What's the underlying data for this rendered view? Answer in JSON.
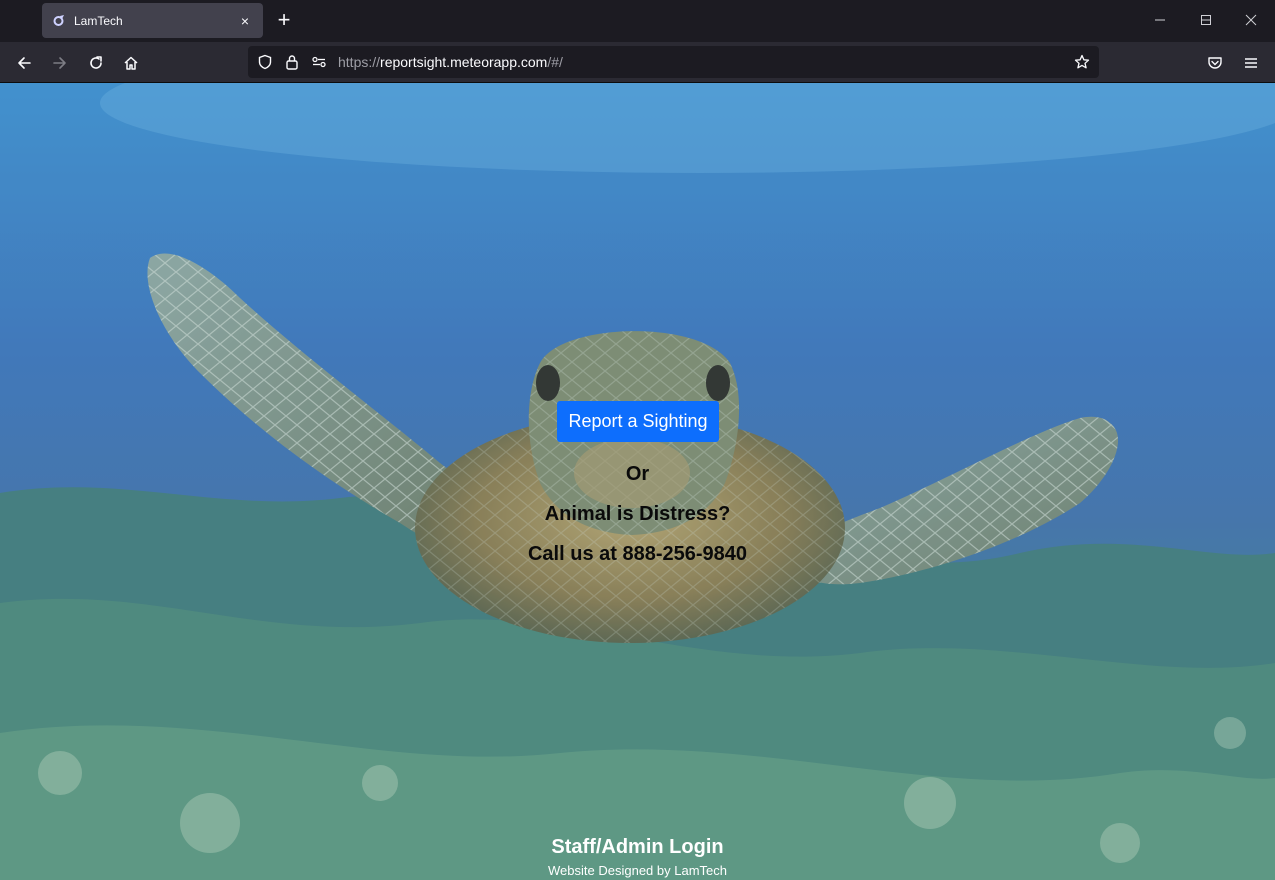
{
  "browser": {
    "tab_title": "LamTech",
    "tab_close": "×",
    "new_tab": "+",
    "url_scheme": "https://",
    "url_host": "reportsight.meteorapp.com",
    "url_path": "/#/"
  },
  "page": {
    "report_button": "Report a Sighting",
    "or_text": "Or",
    "distress_text": "Animal is Distress?",
    "call_text": "Call us at 888-256-9840",
    "login_link": "Staff/Admin Login",
    "credit": "Website Designed by LamTech"
  },
  "colors": {
    "accent": "#0d6efd",
    "chrome_dark": "#1c1b22",
    "toolbar": "#2b2a33"
  }
}
